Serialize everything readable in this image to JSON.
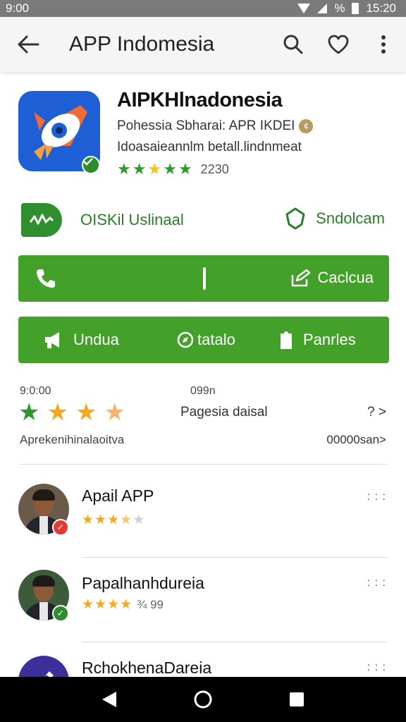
{
  "status_bar": {
    "left_text": "9:00",
    "battery_text": "%",
    "time": "15:20"
  },
  "app_bar": {
    "title": "APP Indomesia",
    "back_icon": "arrow-back-icon",
    "search_icon": "search-icon",
    "favorite_icon": "heart-icon",
    "menu_icon": "more-vert-icon"
  },
  "app": {
    "title": "AIPKHlnadonesia",
    "developer": "Pohessia Sbharai: APR IKDEI",
    "developer_badge": "¢",
    "description": "Idoasaieannlm betall.lindnmeat",
    "rating_stars": 5,
    "rating_count": "2230",
    "verified": true
  },
  "trust": {
    "left_label": "OISKil Uslinaal",
    "right_label": "Sndolcam"
  },
  "action_bar_1": {
    "right_label": "Caclcua"
  },
  "action_bar_2": {
    "seg1_label": "Undua",
    "seg2_label": "tatalo",
    "seg3_label": "Panrles"
  },
  "ratings_summary": {
    "left_small": "9:0:00",
    "center_small": "099n",
    "stars": [
      {
        "color": "#2e9a2e"
      },
      {
        "color": "#f3a91e"
      },
      {
        "color": "#f3a91e"
      },
      {
        "color": "#f7b36a"
      }
    ],
    "middle_text": "Pagesia daisal",
    "right_text": "? >",
    "bottom_left": "Aprekenihinalaoitva",
    "bottom_right": "00000san>"
  },
  "reviews": [
    {
      "name": "Apail APP",
      "stars": [
        1,
        1,
        1,
        0.5,
        0
      ],
      "rating_text": "",
      "badge": "✓",
      "badge_color": "#e53935",
      "menu": ": : :"
    },
    {
      "name": "Papalhanhdureia",
      "stars": [
        1,
        1,
        1,
        0.5,
        0
      ],
      "rating_text": "¾ 99",
      "badge": "✓",
      "badge_color": "#2e8b2e",
      "menu": ": : :"
    },
    {
      "name": "RchokhenaDareia",
      "stars": [],
      "rating_text": "",
      "badge": "",
      "badge_color": "",
      "menu": ": : :"
    }
  ],
  "colors": {
    "accent_green": "#43a12a",
    "trust_green": "#2a7d2a",
    "star_green": "#2e9a2e",
    "star_gold": "#f3a91e"
  }
}
